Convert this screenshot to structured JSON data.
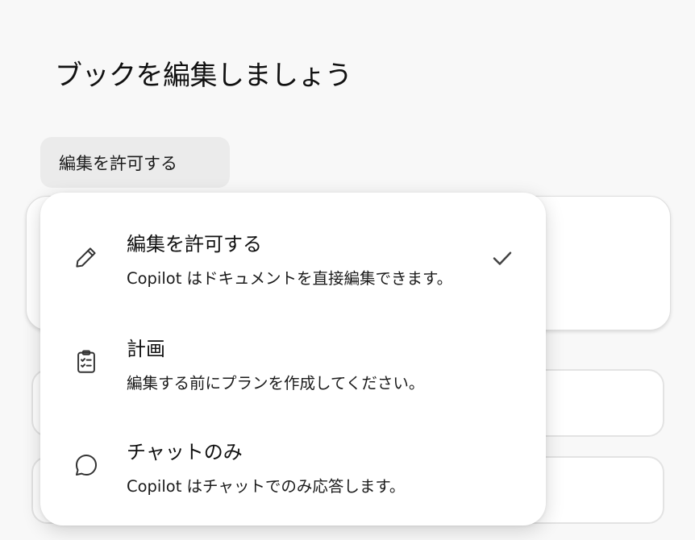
{
  "header": {
    "title": "ブックを編集しましょう"
  },
  "mode_trigger": {
    "label": "編集を許可する"
  },
  "dropdown": {
    "options": [
      {
        "title": "編集を許可する",
        "description": "Copilot はドキュメントを直接編集できます。",
        "icon": "pencil-icon",
        "selected": true
      },
      {
        "title": "計画",
        "description": "編集する前にプランを作成してください。",
        "icon": "clipboard-checklist-icon",
        "selected": false
      },
      {
        "title": "チャットのみ",
        "description": "Copilot はチャットでのみ応答します。",
        "icon": "chat-bubble-icon",
        "selected": false
      }
    ]
  }
}
